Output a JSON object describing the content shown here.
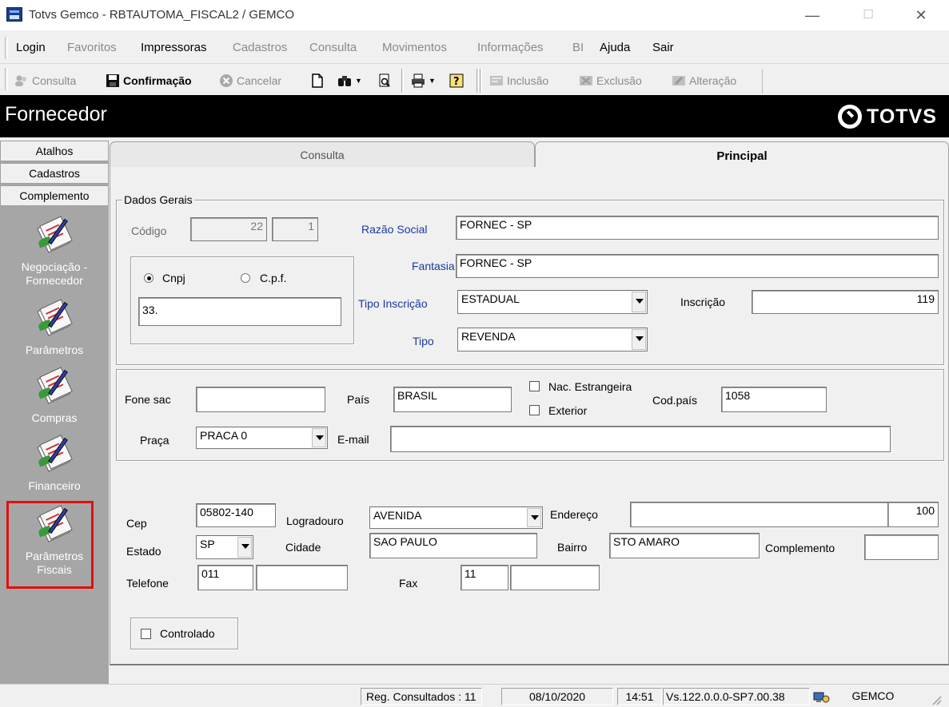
{
  "window": {
    "title": "Totvs Gemco - RBTAUTOMA_FISCAL2 / GEMCO",
    "minimize": "—",
    "maximize": "☐",
    "close": "✕"
  },
  "menu": [
    {
      "label": "Login",
      "enabled": true
    },
    {
      "label": "Favoritos",
      "enabled": false
    },
    {
      "label": "Impressoras",
      "enabled": true
    },
    {
      "label": "Cadastros",
      "enabled": false
    },
    {
      "label": "Consulta",
      "enabled": false
    },
    {
      "label": "Movimentos",
      "enabled": false
    },
    {
      "label": "Informações",
      "enabled": false
    },
    {
      "label": "BI",
      "enabled": false
    },
    {
      "label": "Ajuda",
      "enabled": true
    },
    {
      "label": "Sair",
      "enabled": true
    }
  ],
  "toolbar": {
    "consulta": "Consulta",
    "confirmacao": "Confirmação",
    "cancelar": "Cancelar",
    "inclusao": "Inclusão",
    "exclusao": "Exclusão",
    "alteracao": "Alteração"
  },
  "header": {
    "title": "Fornecedor",
    "logo": "TOTVS"
  },
  "sidebar": {
    "tabs": [
      "Atalhos",
      "Cadastros",
      "Complemento"
    ],
    "items": [
      {
        "label_line1": "Negociação -",
        "label_line2": "Fornecedor"
      },
      {
        "label_line1": "Parâmetros",
        "label_line2": ""
      },
      {
        "label_line1": "Compras",
        "label_line2": ""
      },
      {
        "label_line1": "Financeiro",
        "label_line2": ""
      },
      {
        "label_line1": "Parâmetros",
        "label_line2": "Fiscais"
      }
    ]
  },
  "tabs": {
    "consulta": "Consulta",
    "principal": "Principal"
  },
  "dados_gerais": {
    "legend": "Dados Gerais",
    "codigo_label": "Código",
    "codigo_value": "22",
    "codigo_digit": "1",
    "razao_social_label": "Razão Social",
    "razao_social_value": "FORNEC - SP",
    "fantasia_label": "Fantasia",
    "fantasia_value": "FORNEC - SP",
    "cnpj_label": "Cnpj",
    "cpf_label": "C.p.f.",
    "documento_value": "33.",
    "tipo_inscricao_label": "Tipo Inscrição",
    "tipo_inscricao_value": "ESTADUAL",
    "inscricao_label": "Inscrição",
    "inscricao_value": "119",
    "tipo_label": "Tipo",
    "tipo_value": "REVENDA"
  },
  "contato": {
    "fone_sac_label": "Fone sac",
    "fone_sac_value": "",
    "pais_label": "País",
    "pais_value": "BRASIL",
    "nac_estrangeira_label": "Nac. Estrangeira",
    "exterior_label": "Exterior",
    "cod_pais_label": "Cod.país",
    "cod_pais_value": "1058",
    "praca_label": "Praça",
    "praca_value": "PRACA 0",
    "email_label": "E-mail",
    "email_value": ""
  },
  "endereco": {
    "cep_label": "Cep",
    "cep_value": "05802-140",
    "logradouro_label": "Logradouro",
    "logradouro_value": "AVENIDA",
    "endereco_label": "Endereço",
    "endereco_value": "",
    "numero_value": "100",
    "estado_label": "Estado",
    "estado_value": "SP",
    "cidade_label": "Cidade",
    "cidade_value": "SAO PAULO",
    "bairro_label": "Bairro",
    "bairro_value": "STO AMARO",
    "complemento_label": "Complemento",
    "complemento_value": "",
    "telefone_label": "Telefone",
    "telefone_ddd": "011",
    "telefone_value": "",
    "fax_label": "Fax",
    "fax_ddd": "11",
    "fax_value": "",
    "controlado_label": "Controlado"
  },
  "status": {
    "reg_consultados": "Reg. Consultados : 11",
    "date": "08/10/2020",
    "time": "14:51",
    "version": "Vs.122.0.0.0-SP7.00.38",
    "system": "GEMCO"
  },
  "colors": {
    "header_bg": "#000000",
    "sidebar_bg": "#a6a6a6",
    "highlight": "#e01010",
    "label_blue": "#1a3a9e"
  }
}
